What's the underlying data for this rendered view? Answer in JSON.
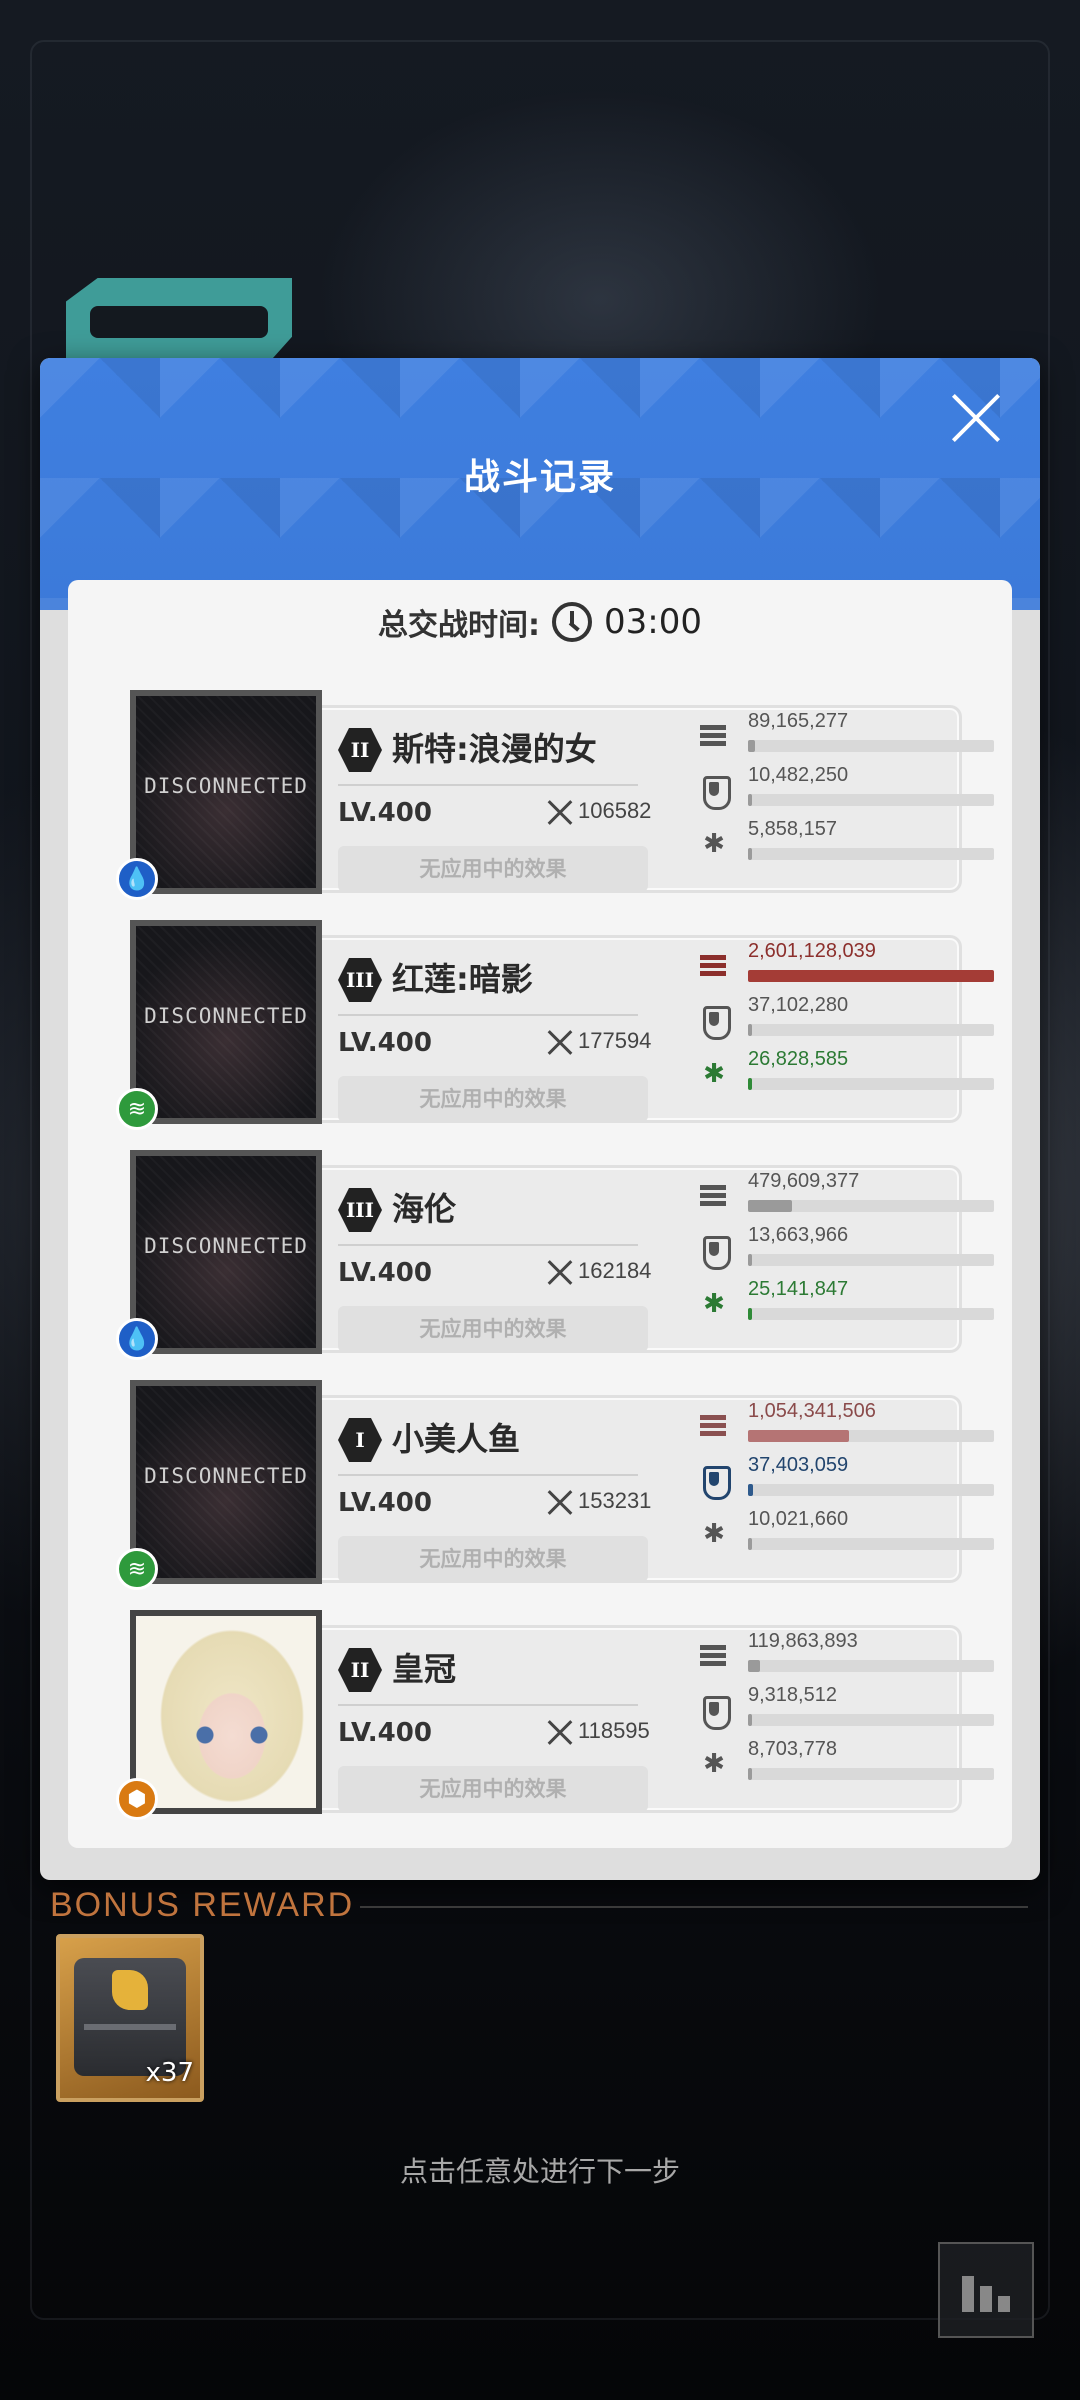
{
  "modal": {
    "title": "战斗记录",
    "duration_label": "总交战时间:",
    "duration_value": "03:00"
  },
  "rows": [
    {
      "name": "斯特:浪漫的女",
      "rank": "II",
      "level": "LV.400",
      "power": "106582",
      "effects": "无应用中的效果",
      "portrait_status": "DISCONNECTED",
      "element": "water",
      "damage": {
        "value": "89,165,277",
        "fill": 0.03
      },
      "shield": {
        "value": "10,482,250",
        "fill": 0.0
      },
      "heal": {
        "value": "5,858,157",
        "fill": 0.0
      }
    },
    {
      "name": "红莲:暗影",
      "rank": "III",
      "level": "LV.400",
      "power": "177594",
      "effects": "无应用中的效果",
      "portrait_status": "DISCONNECTED",
      "element": "wind",
      "damage": {
        "value": "2,601,128,039",
        "fill": 1.0
      },
      "shield": {
        "value": "37,102,280",
        "fill": 0.01
      },
      "heal": {
        "value": "26,828,585",
        "fill": 0.01
      }
    },
    {
      "name": "海伦",
      "rank": "III",
      "level": "LV.400",
      "power": "162184",
      "effects": "无应用中的效果",
      "portrait_status": "DISCONNECTED",
      "element": "water",
      "damage": {
        "value": "479,609,377",
        "fill": 0.18
      },
      "shield": {
        "value": "13,663,966",
        "fill": 0.0
      },
      "heal": {
        "value": "25,141,847",
        "fill": 0.01
      }
    },
    {
      "name": "小美人鱼",
      "rank": "I",
      "level": "LV.400",
      "power": "153231",
      "effects": "无应用中的效果",
      "portrait_status": "DISCONNECTED",
      "element": "wind",
      "damage": {
        "value": "1,054,341,506",
        "fill": 0.41
      },
      "shield": {
        "value": "37,403,059",
        "fill": 0.02
      },
      "heal": {
        "value": "10,021,660",
        "fill": 0.0
      }
    },
    {
      "name": "皇冠",
      "rank": "II",
      "level": "LV.400",
      "power": "118595",
      "effects": "无应用中的效果",
      "portrait_status": "",
      "element": "iron",
      "damage": {
        "value": "119,863,893",
        "fill": 0.05
      },
      "shield": {
        "value": "9,318,512",
        "fill": 0.0
      },
      "heal": {
        "value": "8,703,778",
        "fill": 0.0
      }
    }
  ],
  "bonus": {
    "title": "BONUS REWARD",
    "item_count": "x37"
  },
  "footer": {
    "hint": "点击任意处进行下一步"
  },
  "colors": {
    "header_blue": "#3c7ad9",
    "damage_top": "#a43c36",
    "shield_top": "#2e5a8c",
    "heal_top": "#2f8a37",
    "bonus_orange": "#c0743e"
  }
}
